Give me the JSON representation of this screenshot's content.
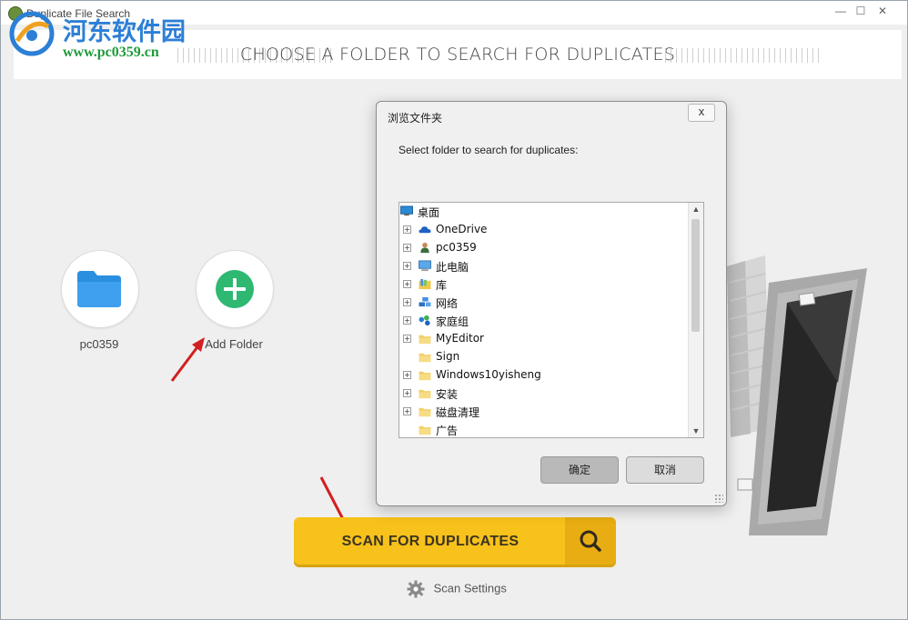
{
  "window": {
    "title": "Duplicate File Search",
    "min_label": "—",
    "max_label": "☐",
    "close_label": "✕"
  },
  "watermark": {
    "site_name": "河东软件园",
    "url": "www.pc0359.cn"
  },
  "header": {
    "title": "CHOOSE A FOLDER TO SEARCH FOR DUPLICATES"
  },
  "folders": [
    {
      "label": "pc0359",
      "icon": "folder-icon"
    }
  ],
  "add_folder": {
    "label": "Add Folder",
    "icon": "plus-icon"
  },
  "scan": {
    "label": "SCAN FOR DUPLICATES",
    "icon": "search-icon"
  },
  "settings": {
    "label": "Scan Settings",
    "icon": "gear-icon"
  },
  "dialog": {
    "title": "浏览文件夹",
    "close_label": "x",
    "prompt": "Select folder to search for duplicates:",
    "tree": [
      {
        "label": "桌面",
        "icon": "desktop-icon",
        "expandable": false,
        "level": 0,
        "selected": true
      },
      {
        "label": "OneDrive",
        "icon": "cloud-icon",
        "expandable": true,
        "level": 1
      },
      {
        "label": "pc0359",
        "icon": "user-icon",
        "expandable": true,
        "level": 1
      },
      {
        "label": "此电脑",
        "icon": "computer-icon",
        "expandable": true,
        "level": 1
      },
      {
        "label": "库",
        "icon": "library-icon",
        "expandable": true,
        "level": 1
      },
      {
        "label": "网络",
        "icon": "network-icon",
        "expandable": true,
        "level": 1
      },
      {
        "label": "家庭组",
        "icon": "homegroup-icon",
        "expandable": true,
        "level": 1
      },
      {
        "label": "MyEditor",
        "icon": "folder-icon",
        "expandable": true,
        "level": 1
      },
      {
        "label": "Sign",
        "icon": "folder-icon",
        "expandable": false,
        "level": 1
      },
      {
        "label": "Windows10yisheng",
        "icon": "folder-icon",
        "expandable": true,
        "level": 1
      },
      {
        "label": "安装",
        "icon": "folder-icon",
        "expandable": true,
        "level": 1
      },
      {
        "label": "磁盘清理",
        "icon": "folder-icon",
        "expandable": true,
        "level": 1
      },
      {
        "label": "广告",
        "icon": "folder-icon",
        "expandable": false,
        "level": 1
      }
    ],
    "ok_label": "确定",
    "cancel_label": "取消"
  },
  "colors": {
    "scan_button": "#f7c21b",
    "scan_button_dark": "#e8ad12",
    "add_folder_green": "#2eb872",
    "folder_blue": "#2b8fe0",
    "arrow_red": "#d31f1f"
  }
}
